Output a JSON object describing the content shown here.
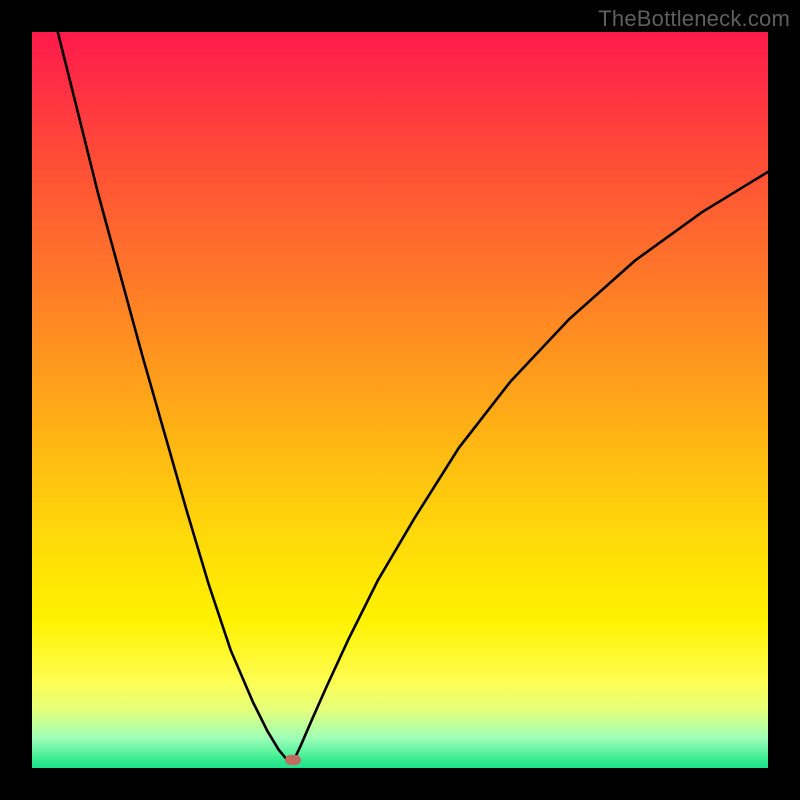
{
  "watermark": "TheBottleneck.com",
  "marker": {
    "x_ratio": 0.355,
    "y_ratio": 0.989,
    "color": "#c26b5f"
  },
  "chart_data": {
    "type": "line",
    "title": "",
    "xlabel": "",
    "ylabel": "",
    "xlim": [
      0,
      1
    ],
    "ylim": [
      0,
      1
    ],
    "series": [
      {
        "name": "left-branch",
        "x": [
          0.035,
          0.06,
          0.09,
          0.12,
          0.15,
          0.18,
          0.21,
          0.24,
          0.27,
          0.3,
          0.32,
          0.335,
          0.345,
          0.353
        ],
        "y": [
          0.0,
          0.1,
          0.22,
          0.33,
          0.44,
          0.545,
          0.65,
          0.75,
          0.84,
          0.91,
          0.95,
          0.975,
          0.987,
          0.989
        ]
      },
      {
        "name": "right-branch",
        "x": [
          0.356,
          0.365,
          0.38,
          0.4,
          0.43,
          0.47,
          0.52,
          0.58,
          0.65,
          0.73,
          0.82,
          0.91,
          1.0
        ],
        "y": [
          0.989,
          0.97,
          0.935,
          0.89,
          0.825,
          0.745,
          0.66,
          0.565,
          0.475,
          0.39,
          0.31,
          0.245,
          0.19
        ]
      }
    ],
    "optimum": {
      "x": 0.355,
      "y": 0.989
    },
    "background_gradient": {
      "top": "#ff1a4b",
      "mid": "#fff200",
      "bottom": "#1de28d"
    }
  }
}
